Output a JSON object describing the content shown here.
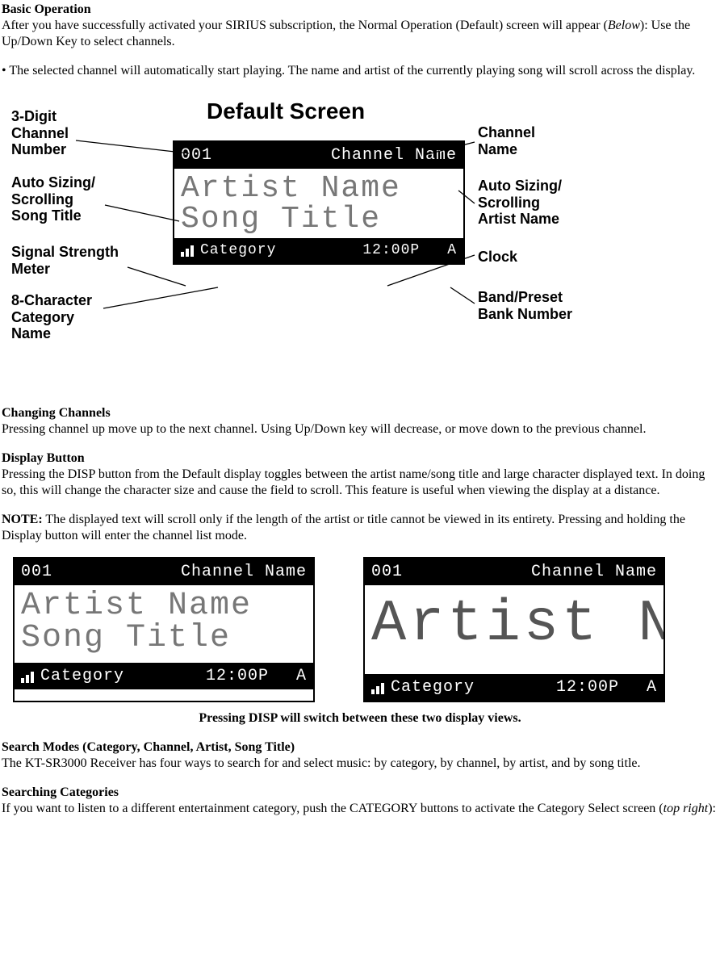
{
  "sections": {
    "basic_operation": {
      "heading": "Basic Operation",
      "p1a": "After you have successfully activated your SIRIUS subscription, the Normal Operation (Default) screen will appear (",
      "p1b": "Below",
      "p1c": "): Use the Up/Down Key to select channels.",
      "bullet1": "• The selected channel will automatically start playing. The name and artist of the currently playing song will scroll across the display."
    },
    "changing_channels": {
      "heading": "Changing Channels",
      "p1": "Pressing channel up move up to the next channel. Using Up/Down key will decrease, or move down to the previous channel."
    },
    "display_button": {
      "heading": "Display Button",
      "p1": "Pressing the DISP button from the Default display toggles between the artist name/song title and large character displayed text. In doing so, this will change the character size and cause the field to scroll. This feature is useful when viewing the display at a distance.",
      "note_label": "NOTE:",
      "note_text": " The displayed text will scroll only if the length of the artist or title cannot be viewed in its entirety. Pressing and holding the Display button will enter the channel list mode."
    },
    "search_modes": {
      "heading": "Search Modes (Category, Channel, Artist, Song Title)",
      "p1": "The KT-SR3000 Receiver has four ways to search for and select music: by category, by channel, by artist, and by song title."
    },
    "searching_categories": {
      "heading": "Searching Categories",
      "p1a": "If you want to listen to a different entertainment category, push the CATEGORY buttons to activate the Category Select screen (",
      "p1b": "top right",
      "p1c": "):"
    }
  },
  "diagram": {
    "title": "Default Screen",
    "lcd": {
      "channel_num": "001",
      "channel_name": "Channel Name",
      "artist": "Artist Name",
      "song": "Song Title",
      "category": "Category",
      "clock": "12:00P",
      "bank": "A",
      "big_artist": "Artist N"
    },
    "labels": {
      "l_channel_num": "3-Digit\nChannel\nNumber",
      "l_song_title": "Auto Sizing/\nScrolling\nSong Title",
      "l_signal": "Signal Strength\nMeter",
      "l_category": "8-Character\nCategory\nName",
      "r_channel_name": "Channel\nName",
      "r_artist": "Auto Sizing/\nScrolling\nArtist Name",
      "r_clock": "Clock",
      "r_bank": "Band/Preset\nBank Number"
    }
  },
  "caption": "Pressing DISP will switch between these two display views."
}
